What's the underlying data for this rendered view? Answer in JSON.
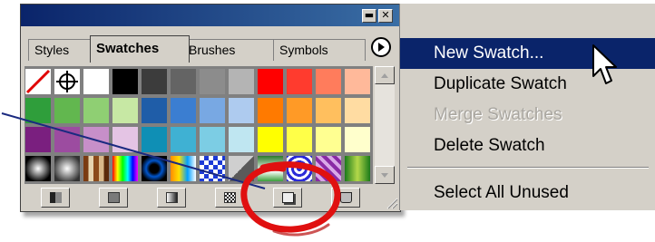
{
  "panel": {
    "window_buttons": {
      "minimize": "▬",
      "close": "✕"
    },
    "tabs": [
      {
        "label": "Styles"
      },
      {
        "label": "Swatches"
      },
      {
        "label": "Brushes"
      },
      {
        "label": "Symbols"
      }
    ],
    "tab_menu_icon": "triangle-right-icon"
  },
  "swatches": {
    "rows": [
      [
        "none",
        "#ffffff",
        "#ffffff",
        "#000000",
        "#3c3c3c",
        "#646464",
        "#8c8c8c",
        "#b4b4b4",
        "#ff0000",
        "#ff3b2e",
        "#ff7c5c",
        "#ffb99a"
      ],
      [
        "#2f9e3b",
        "#62b74f",
        "#8fcf73",
        "#c7e8a4",
        "#1f5da8",
        "#3b7ed1",
        "#78a8e3",
        "#aecbef",
        "#ff7a00",
        "#ff9a26",
        "#ffbf5e",
        "#ffdca2"
      ],
      [
        "#7a1f7f",
        "#9c4ca0",
        "#c78fc9",
        "#e4c4e4",
        "#0f8fb5",
        "#3fb1d3",
        "#7ccde4",
        "#bfe6f1",
        "#ffff00",
        "#ffff48",
        "#ffff91",
        "#ffffcc"
      ],
      [
        "radial-black",
        "radial-gray",
        "wood",
        "spectrum",
        "radial-blue",
        "radial-blue-2",
        "checker-blue",
        "gray-triangle",
        "gradient-green",
        "pattern-blue",
        "pattern-purple",
        "pattern-green"
      ]
    ]
  },
  "bottom_buttons": [
    {
      "icon": "swatch-libraries-icon"
    },
    {
      "icon": "color-swatch-icon"
    },
    {
      "icon": "gradient-swatch-icon"
    },
    {
      "icon": "pattern-swatch-icon"
    },
    {
      "icon": "new-swatch-icon"
    },
    {
      "icon": "trash-icon"
    }
  ],
  "menu": {
    "items": [
      {
        "label": "New Swatch...",
        "state": "highlighted"
      },
      {
        "label": "Duplicate Swatch",
        "state": "enabled"
      },
      {
        "label": "Merge Swatches",
        "state": "disabled"
      },
      {
        "label": "Delete Swatch",
        "state": "enabled"
      },
      {
        "label": "Select All Unused",
        "state": "enabled"
      }
    ]
  },
  "colors": {
    "highlight": "#0a246a",
    "panel_bg": "#d4d0c8",
    "annotation_circle": "#e01010",
    "callout_line": "#1a2a80"
  }
}
